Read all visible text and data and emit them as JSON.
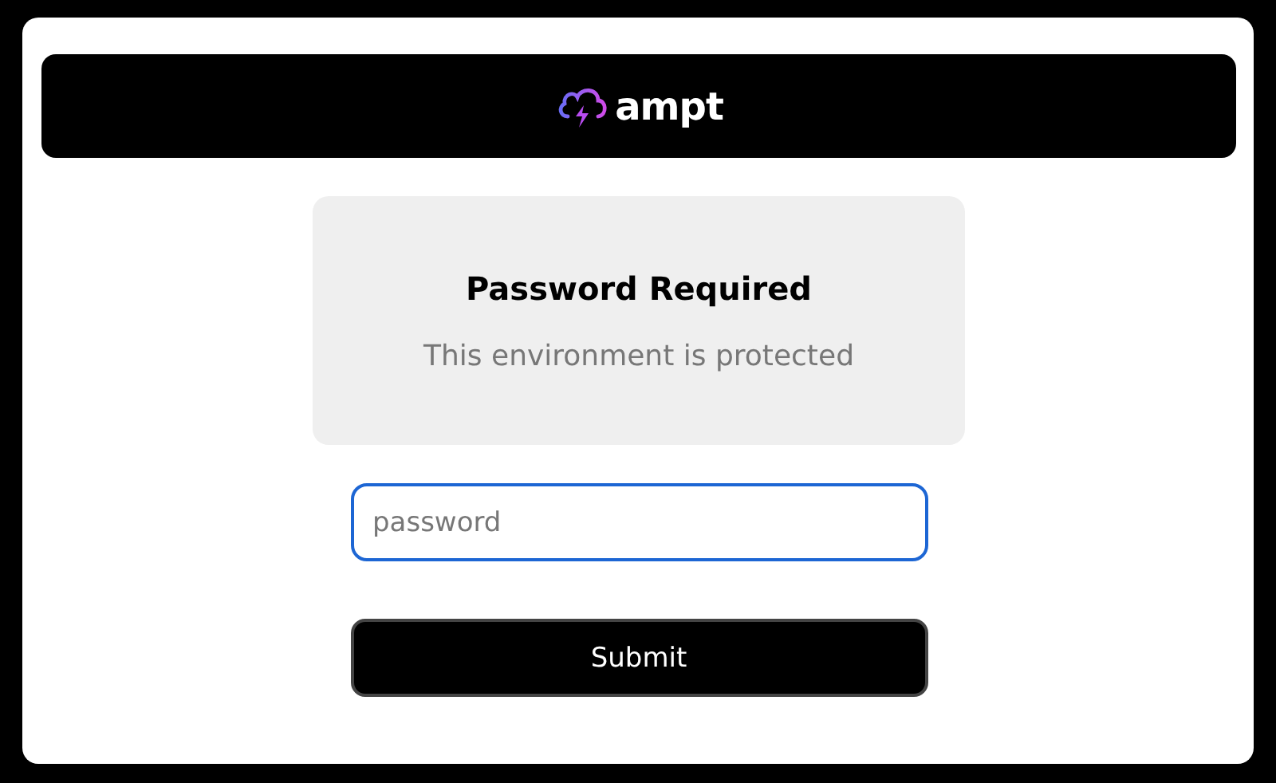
{
  "header": {
    "brand": "ampt"
  },
  "notice": {
    "title": "Password Required",
    "message": "This environment is protected"
  },
  "password_field": {
    "placeholder": "password",
    "focused": true
  },
  "submit_button": {
    "label": "Submit"
  }
}
